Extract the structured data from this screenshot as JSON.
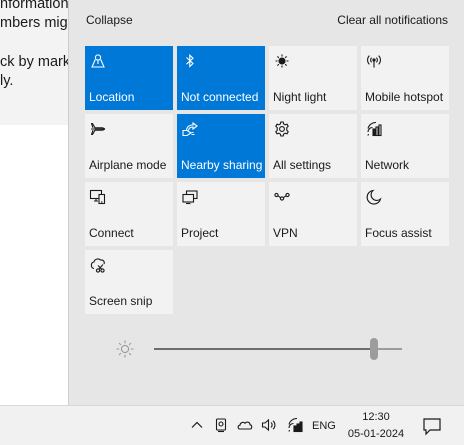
{
  "background_window": {
    "lines": [
      "nformation",
      "mbers mig",
      "ck by mark",
      "ly."
    ]
  },
  "panel": {
    "collapse_label": "Collapse",
    "clear_label": "Clear all notifications",
    "accent": "#0078d7",
    "tiles": [
      {
        "label": "Location",
        "icon": "location-icon",
        "active": true
      },
      {
        "label": "Not connected",
        "icon": "bluetooth-icon",
        "active": true
      },
      {
        "label": "Night light",
        "icon": "sun-icon",
        "active": false
      },
      {
        "label": "Mobile hotspot",
        "icon": "hotspot-icon",
        "active": false
      },
      {
        "label": "Airplane mode",
        "icon": "airplane-icon",
        "active": false
      },
      {
        "label": "Nearby sharing",
        "icon": "share-icon",
        "active": true
      },
      {
        "label": "All settings",
        "icon": "gear-icon",
        "active": false
      },
      {
        "label": "Network",
        "icon": "network-icon",
        "active": false
      },
      {
        "label": "Connect",
        "icon": "connect-icon",
        "active": false
      },
      {
        "label": "Project",
        "icon": "project-icon",
        "active": false
      },
      {
        "label": "VPN",
        "icon": "vpn-icon",
        "active": false
      },
      {
        "label": "Focus assist",
        "icon": "moon-icon",
        "active": false
      },
      {
        "label": "Screen snip",
        "icon": "screen-snip-icon",
        "active": false
      }
    ],
    "brightness": {
      "value": 90
    }
  },
  "taskbar": {
    "language": "ENG",
    "time": "12:30",
    "date": "05-01-2024"
  }
}
